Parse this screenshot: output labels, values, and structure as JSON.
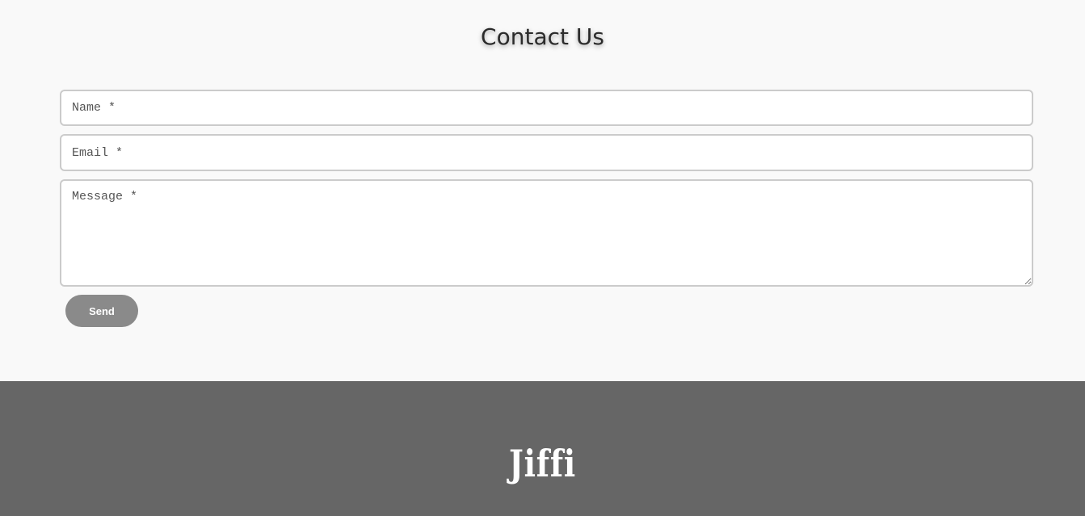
{
  "contact": {
    "title": "Contact Us",
    "name_placeholder": "Name *",
    "email_placeholder": "Email *",
    "message_placeholder": "Message *",
    "send_label": "Send"
  },
  "footer": {
    "logo_text": "Jiffi"
  },
  "colors": {
    "page_background": "#f9f9f9",
    "footer_background": "#666666",
    "button_background": "#8a8a8a",
    "field_border": "#cbcbcb"
  }
}
